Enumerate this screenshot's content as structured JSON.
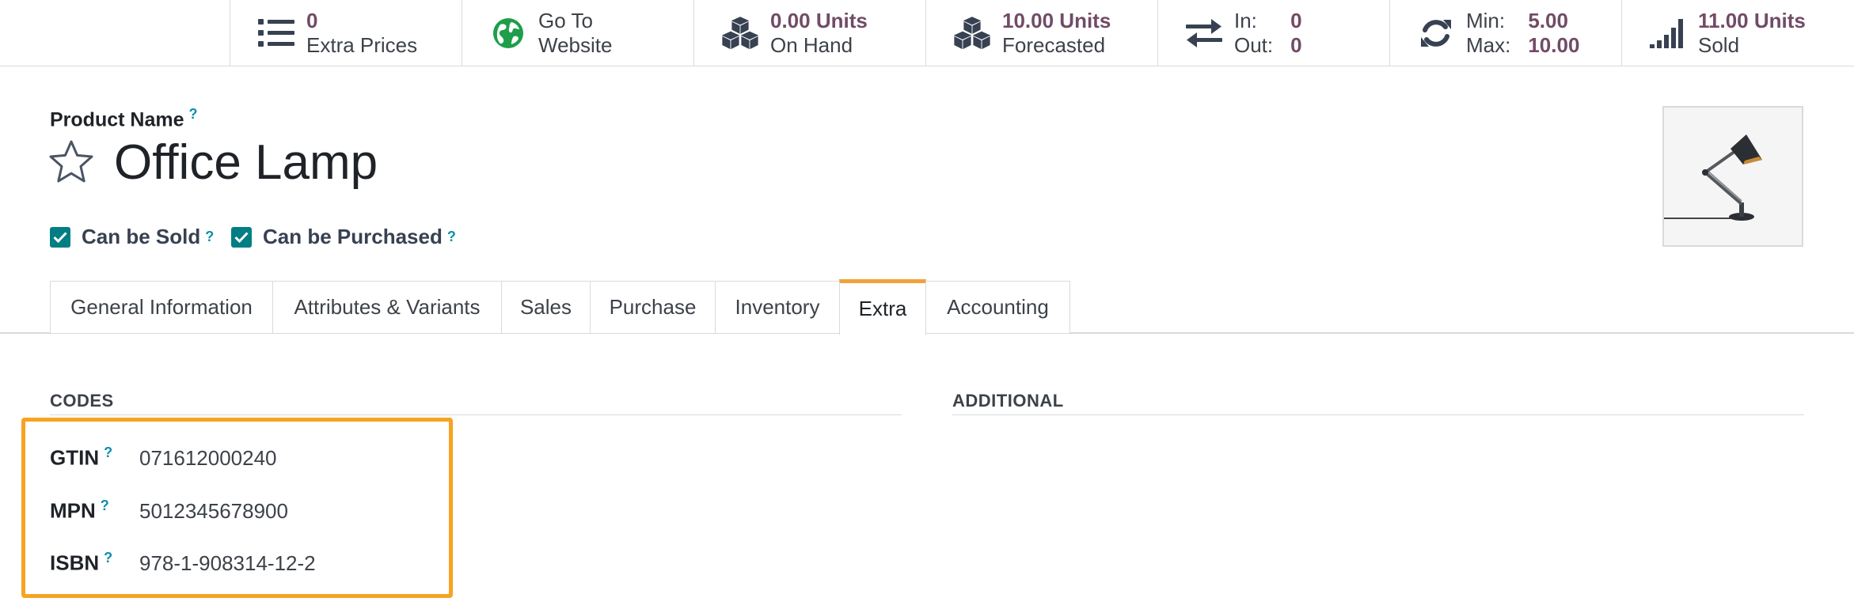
{
  "smart_buttons": [
    {
      "id": "extra-prices",
      "icon": "list-icon",
      "value": "0",
      "label": "Extra Prices"
    },
    {
      "id": "go-to-website",
      "icon": "globe-icon",
      "line1": "Go To",
      "line2": "Website"
    },
    {
      "id": "on-hand",
      "icon": "cubes-icon",
      "value": "0.00 Units",
      "label": "On Hand"
    },
    {
      "id": "forecasted",
      "icon": "cubes-icon",
      "value": "10.00 Units",
      "label": "Forecasted"
    },
    {
      "id": "in-out",
      "icon": "exchange-icon",
      "in_label": "In:",
      "in_value": "0",
      "out_label": "Out:",
      "out_value": "0"
    },
    {
      "id": "min-max",
      "icon": "refresh-icon",
      "min_label": "Min:",
      "min_value": "5.00",
      "max_label": "Max:",
      "max_value": "10.00"
    },
    {
      "id": "sold",
      "icon": "signal-icon",
      "value": "11.00 Units",
      "label": "Sold"
    }
  ],
  "product": {
    "name_label": "Product Name",
    "help_mark": "?",
    "name": "Office Lamp",
    "can_be_sold_label": "Can be Sold",
    "can_be_sold": true,
    "can_be_purchased_label": "Can be Purchased",
    "can_be_purchased": true,
    "image_icon": "desk-lamp-icon"
  },
  "tabs": [
    {
      "label": "General Information",
      "active": false
    },
    {
      "label": "Attributes & Variants",
      "active": false
    },
    {
      "label": "Sales",
      "active": false
    },
    {
      "label": "Purchase",
      "active": false
    },
    {
      "label": "Inventory",
      "active": false
    },
    {
      "label": "Extra",
      "active": true
    },
    {
      "label": "Accounting",
      "active": false
    }
  ],
  "extra": {
    "codes_title": "CODES",
    "additional_title": "ADDITIONAL",
    "fields": [
      {
        "label": "GTIN",
        "value": "071612000240"
      },
      {
        "label": "MPN",
        "value": "5012345678900"
      },
      {
        "label": "ISBN",
        "value": "978-1-908314-12-2"
      }
    ]
  },
  "colors": {
    "accent_purple": "#714b67",
    "checkbox_teal": "#017e84",
    "help_teal": "#0a8fa8",
    "highlight_orange": "#f7a322",
    "active_tab_orange": "#f0a33a",
    "globe_green": "#1e9e4a"
  }
}
